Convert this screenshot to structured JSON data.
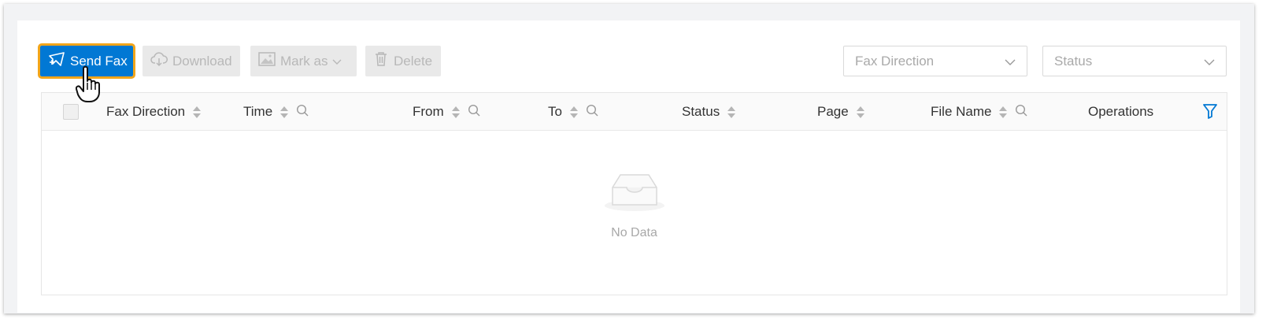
{
  "toolbar": {
    "send_fax_label": "Send Fax",
    "download_label": "Download",
    "mark_as_label": "Mark as",
    "delete_label": "Delete"
  },
  "filters": {
    "fax_direction_placeholder": "Fax Direction",
    "status_placeholder": "Status"
  },
  "table": {
    "columns": [
      {
        "label": "Fax Direction",
        "sortable": true,
        "searchable": false
      },
      {
        "label": "Time",
        "sortable": true,
        "searchable": true
      },
      {
        "label": "From",
        "sortable": true,
        "searchable": true
      },
      {
        "label": "To",
        "sortable": true,
        "searchable": true
      },
      {
        "label": "Status",
        "sortable": true,
        "searchable": false
      },
      {
        "label": "Page",
        "sortable": true,
        "searchable": false
      },
      {
        "label": "File Name",
        "sortable": true,
        "searchable": true
      },
      {
        "label": "Operations",
        "sortable": false,
        "searchable": false
      }
    ],
    "rows": [],
    "empty_text": "No Data"
  },
  "icons": {
    "send_fax": "send-fax-icon",
    "download": "cloud-download-icon",
    "mark_as": "image-icon",
    "delete": "trash-icon",
    "sort": "sort-icon",
    "search": "search-icon",
    "filter": "filter-icon",
    "empty": "empty-inbox-icon",
    "cursor": "hand-pointer-icon"
  },
  "colors": {
    "primary": "#0178d4",
    "highlight": "#f2a51a",
    "disabled_bg": "#e9e9e9",
    "disabled_text": "#b8b8b8"
  }
}
